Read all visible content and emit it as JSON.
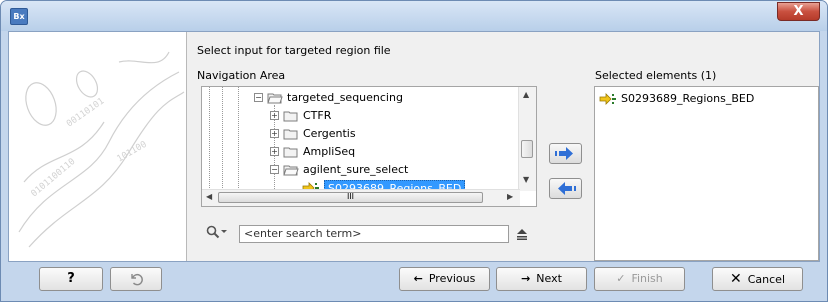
{
  "window": {
    "title": "",
    "close_glyph": "X",
    "app_icon_text": "Bx"
  },
  "wizard": {
    "prompt": "Select input for targeted region file",
    "navigation_label": "Navigation Area",
    "selected_label": "Selected elements (1)"
  },
  "tree": {
    "items": [
      {
        "label": "targeted_sequencing",
        "expander": "−",
        "icon": "folder-open-icon"
      },
      {
        "label": "CTFR",
        "expander": "+",
        "icon": "folder-icon"
      },
      {
        "label": "Cergentis",
        "expander": "+",
        "icon": "folder-icon"
      },
      {
        "label": "AmpliSeq",
        "expander": "+",
        "icon": "folder-icon"
      },
      {
        "label": "agilent_sure_select",
        "expander": "−",
        "icon": "folder-open-icon"
      },
      {
        "label": "S0293689_Regions_BED",
        "expander": "",
        "icon": "annotation-track-icon",
        "selected": true
      }
    ],
    "hscroll_grip": "III"
  },
  "selected_list": {
    "items": [
      {
        "label": "S0293689_Regions_BED",
        "icon": "annotation-track-icon"
      }
    ]
  },
  "search": {
    "placeholder": "<enter search term>"
  },
  "footer": {
    "help_label": "?",
    "previous_label": "Previous",
    "next_label": "Next",
    "finish_label": "Finish",
    "cancel_label": "Cancel"
  },
  "colors": {
    "selection": "#3399ff",
    "arrow_blue": "#2f6fd6",
    "chrome": "#c4d6ec"
  }
}
